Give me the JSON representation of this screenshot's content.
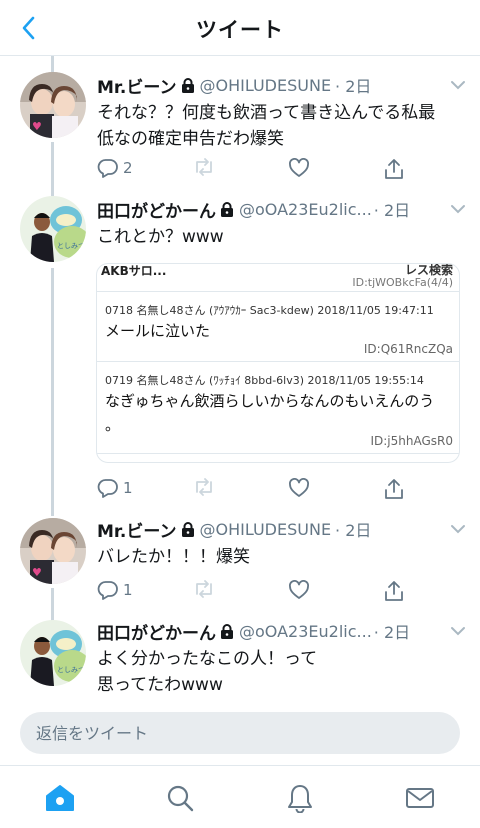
{
  "header": {
    "title": "ツイート"
  },
  "tweets": [
    {
      "name": "Mr.ビーン",
      "handle": "@OHILUDESUNE",
      "time": "· 2日",
      "text_lines": [
        "それな？？何度も飲酒って書き込んでる私最",
        "低なの確定申告だわ爆笑"
      ],
      "reply_count": "2",
      "retweet_count": "",
      "like_count": ""
    },
    {
      "name": "田口がどかーん",
      "handle": "@oOA23Eu2lic...",
      "time": "· 2日",
      "text_lines": [
        "これとか？www"
      ],
      "reply_count": "1",
      "retweet_count": "",
      "like_count": "",
      "embed": {
        "title": "AKBサロ...",
        "right_label": "レス検索",
        "top_id": "ID:tjWOBkcFa(4/4)",
        "posts": [
          {
            "meta": "0718 名無し48さん (ｱｳｱｳｶｰ Sac3-kdew) 2018/11/05 19:47:11",
            "text_lines": [
              "メールに泣いた"
            ],
            "id": "ID:Q61RncZQa"
          },
          {
            "meta": "0719 名無し48さん (ﾜｯﾁｮｲ 8bbd-6lv3) 2018/11/05 19:55:14",
            "text_lines": [
              "なぎゅちゃん飲酒らしいからなんのもいえんのう",
              "。"
            ],
            "id": "ID:j5hhAGsR0"
          }
        ]
      }
    },
    {
      "name": "Mr.ビーン",
      "handle": "@OHILUDESUNE",
      "time": "· 2日",
      "text_lines": [
        "バレたか！！！爆笑"
      ],
      "reply_count": "1",
      "retweet_count": "",
      "like_count": ""
    },
    {
      "name": "田口がどかーん",
      "handle": "@oOA23Eu2lic...",
      "time": "· 2日",
      "text_lines": [
        "よく分かったなこの人！って",
        "思ってたわwww"
      ]
    }
  ],
  "reply": {
    "placeholder": "返信をツイート"
  },
  "tabbar": {
    "items": [
      {
        "icon": "home-icon",
        "active": true
      },
      {
        "icon": "search-icon",
        "active": false
      },
      {
        "icon": "bell-icon",
        "active": false
      },
      {
        "icon": "mail-icon",
        "active": false
      }
    ]
  },
  "colors": {
    "accent": "#1da1f2",
    "text": "#14171a",
    "secondary": "#657786",
    "divider": "#e1e8ed"
  }
}
